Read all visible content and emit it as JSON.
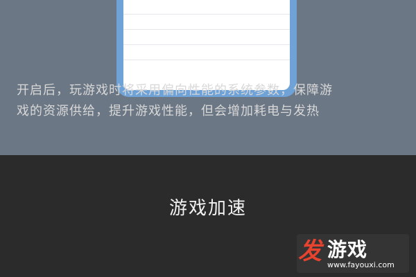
{
  "dialog": {
    "title": "游戏加速",
    "description_line1": "开启后，玩游戏时将采用偏向性能的系统参数，保障游",
    "description_line2": "戏的资源供给，提升游戏性能，但会增加耗电与发热"
  },
  "watermark": {
    "logo_char": "发",
    "brand": "游戏",
    "url": "www.fayouxi.com"
  },
  "colors": {
    "backdrop": "#6b7784",
    "phone_frame": "#6fa3d8",
    "sheet": "#2b2b2b",
    "logo": "#e8432f"
  }
}
